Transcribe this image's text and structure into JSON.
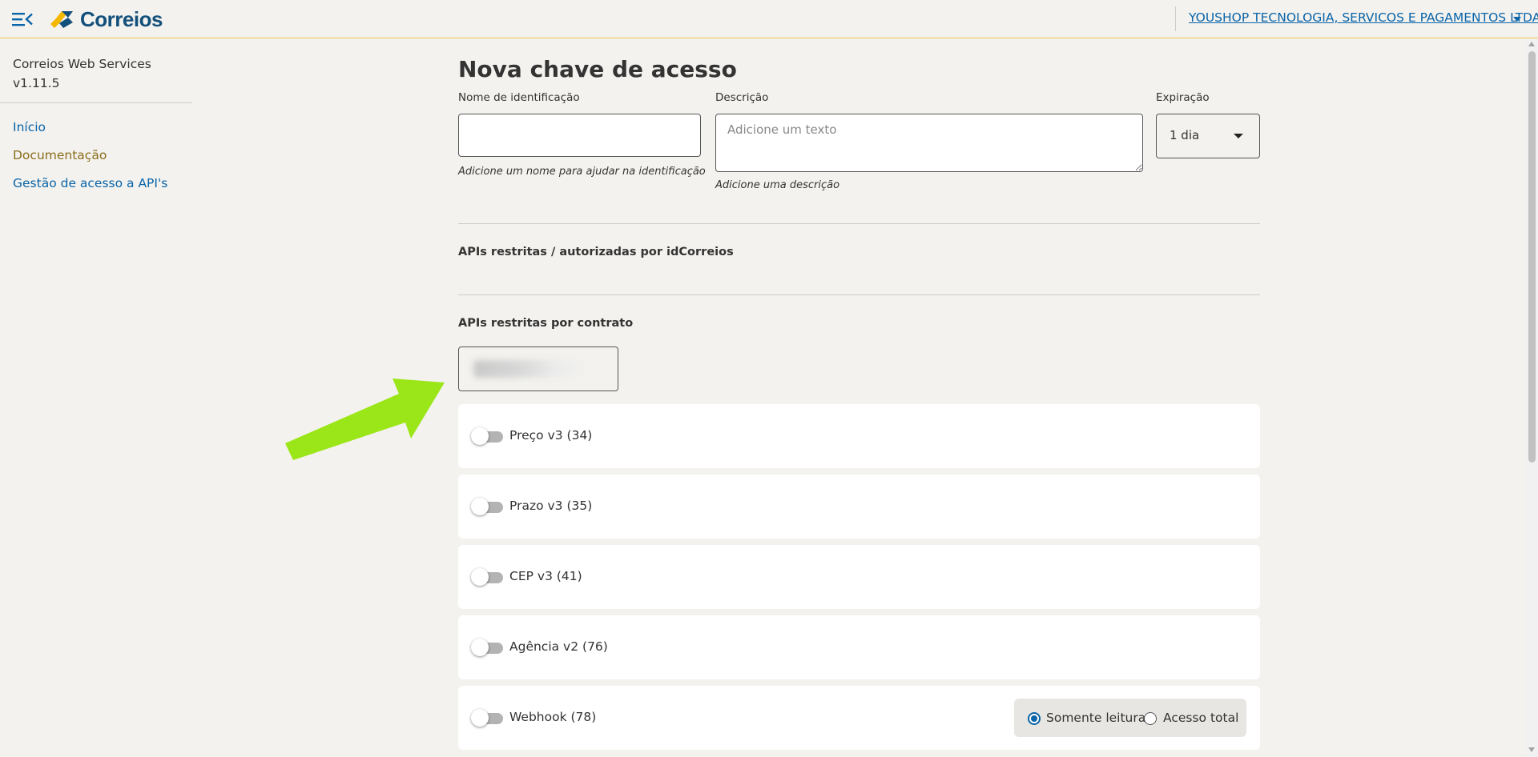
{
  "header": {
    "logo_text": "Correios",
    "company": "YOUSHOP TECNOLOGIA, SERVICOS E PAGAMENTOS LTDA."
  },
  "sidebar": {
    "app_name": "Correios Web Services",
    "version": "v1.11.5",
    "items": [
      {
        "label": "Início",
        "color": "#0a64a8"
      },
      {
        "label": "Documentação",
        "color": "#8a6d1a"
      },
      {
        "label": "Gestão de acesso a API's",
        "color": "#0a64a8"
      }
    ]
  },
  "main": {
    "title": "Nova chave de acesso",
    "name_field": {
      "label": "Nome de identificação",
      "value": "",
      "helper": "Adicione um nome para ajudar na identificação"
    },
    "description_field": {
      "label": "Descrição",
      "placeholder": "Adicione um texto",
      "helper": "Adicione uma descrição"
    },
    "expiration_field": {
      "label": "Expiração",
      "value": "1 dia"
    },
    "section_idcorreios": "APIs restritas / autorizadas por idCorreios",
    "section_contract": "APIs restritas por contrato",
    "apis": [
      {
        "label": "Preço v3 (34)",
        "enabled": false
      },
      {
        "label": "Prazo v3 (35)",
        "enabled": false
      },
      {
        "label": "CEP v3 (41)",
        "enabled": false
      },
      {
        "label": "Agência v2 (76)",
        "enabled": false
      },
      {
        "label": "Webhook (78)",
        "enabled": false
      }
    ],
    "webhook_permissions": {
      "read_only": "Somente leitura",
      "full_access": "Acesso total",
      "selected": "read_only"
    }
  },
  "colors": {
    "accent": "#0a64a8",
    "arrow": "#9be619",
    "header_border": "#f0c54a"
  }
}
